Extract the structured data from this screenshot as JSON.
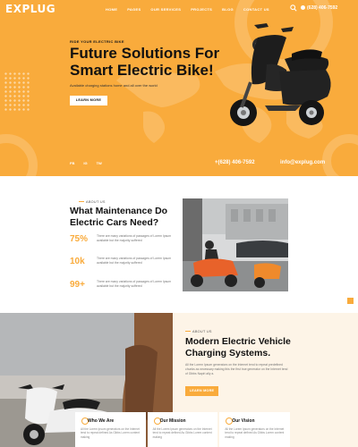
{
  "nav": {
    "logo": "EXPLUG",
    "menu": [
      "HOME",
      "PAGES",
      "OUR SERVICES",
      "PROJECTS",
      "BLOG",
      "CONTACT US"
    ],
    "phone": "(628) 406-7592"
  },
  "hero": {
    "eyebrow": "RIDE YOUR ELECTRIC BIKE",
    "title_line1": "Future Solutions For",
    "title_line2": "Smart Electric Bike!",
    "subtitle": "Available charging stations home and all over the world",
    "button": "LEARN MORE",
    "phone": "+(628) 406-7592",
    "email": "info@explug.com",
    "socials": [
      "FB",
      "IG",
      "TW"
    ]
  },
  "maintenance": {
    "eyebrow": "ABOUT US",
    "title": "What Maintenance Do Electric Cars Need?",
    "stats": [
      {
        "num": "75%",
        "desc": "There are many variations of passages of Lorem Ipsum available but the majority suffered"
      },
      {
        "num": "10k",
        "desc": "There are many variations of passages of Lorem Ipsum available but the majority suffered"
      },
      {
        "num": "99+",
        "desc": "There are many variations of passages of Lorem Ipsum available but the majority suffered"
      }
    ]
  },
  "modern": {
    "eyebrow": "ABOUT US",
    "title": "Modern Electric Vehicle Charging Systems.",
    "text": "All the Lorem Ipsum generators on the Internet tend to repeat predefined chunks as necessary making this the first true generator on the Internet tend of Gibbs Napiri ally a.",
    "button": "LEARN MORE"
  },
  "cards": [
    {
      "title": "Who We Are",
      "text": "All the Lorem Ipsum generators on the Internet tend to repeat defined As Gibbs Lorem content making"
    },
    {
      "title": "Our Mission",
      "text": "All the Lorem Ipsum generators on the Internet tend to repeat defined As Gibbs Lorem content making"
    },
    {
      "title": "Our Vision",
      "text": "All the Lorem Ipsum generators on the Internet tend to repeat defined As Gibbs Lorem content making"
    }
  ],
  "colors": {
    "accent": "#f9ab3c",
    "dark": "#111111"
  }
}
